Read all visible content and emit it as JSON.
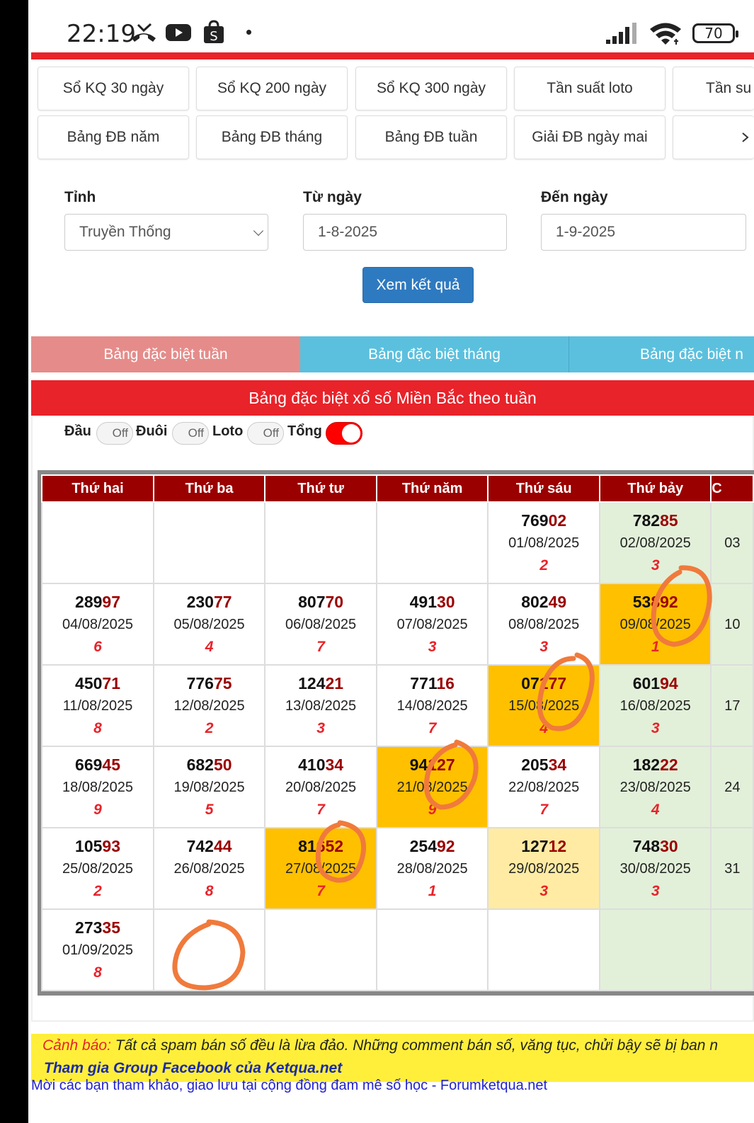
{
  "status_bar": {
    "time": "22:19",
    "battery": "70",
    "icons": [
      "missed-call-icon",
      "youtube-icon",
      "shopee-icon",
      "signal-icon",
      "wifi-icon",
      "battery-icon"
    ]
  },
  "menu": {
    "row1": [
      "Sổ KQ 30 ngày",
      "Sổ KQ 200 ngày",
      "Sổ KQ 300 ngày",
      "Tần suất loto",
      "Tần su"
    ],
    "row2": [
      "Bảng ĐB năm",
      "Bảng ĐB tháng",
      "Bảng ĐB tuần",
      "Giải ĐB ngày mai",
      ""
    ]
  },
  "form": {
    "province_label": "Tỉnh",
    "province_value": "Truyền Thống",
    "from_label": "Từ ngày",
    "from_value": "1-8-2025",
    "to_label": "Đến ngày",
    "to_value": "1-9-2025",
    "submit_label": "Xem kết quả"
  },
  "tabs": [
    {
      "label": "Bảng đặc biệt tuần",
      "color": "#e58c8a"
    },
    {
      "label": "Bảng đặc biệt tháng",
      "color": "#5bc0de"
    },
    {
      "label": "Bảng đặc biệt n",
      "color": "#5bc0de"
    }
  ],
  "section_title": "Bảng đặc biệt xổ số Miền Bắc theo tuần",
  "toggles": {
    "dau": "Đầu",
    "duoi": "Đuôi",
    "loto": "Loto",
    "tong": "Tổng",
    "off_text": "Off"
  },
  "table": {
    "headers": [
      "Thứ hai",
      "Thứ ba",
      "Thứ tư",
      "Thứ năm",
      "Thứ sáu",
      "Thứ bảy",
      "C"
    ],
    "rows": [
      [
        {
          "empty": true
        },
        {
          "empty": true
        },
        {
          "empty": true
        },
        {
          "empty": true
        },
        {
          "head": "769",
          "tail": "02",
          "date": "01/08/2025",
          "sum": "2"
        },
        {
          "head": "782",
          "tail": "85",
          "date": "02/08/2025",
          "sum": "3",
          "bg": "sat"
        },
        {
          "date": "03",
          "bg": "sun"
        }
      ],
      [
        {
          "head": "289",
          "tail": "97",
          "date": "04/08/2025",
          "sum": "6"
        },
        {
          "head": "230",
          "tail": "77",
          "date": "05/08/2025",
          "sum": "4"
        },
        {
          "head": "807",
          "tail": "70",
          "date": "06/08/2025",
          "sum": "7"
        },
        {
          "head": "491",
          "tail": "30",
          "date": "07/08/2025",
          "sum": "3"
        },
        {
          "head": "802",
          "tail": "49",
          "date": "08/08/2025",
          "sum": "3"
        },
        {
          "head": "53",
          "tail": "892",
          "date": "09/08/2025",
          "sum": "1",
          "bg": "orange"
        },
        {
          "date": "10",
          "bg": "sun"
        }
      ],
      [
        {
          "head": "450",
          "tail": "71",
          "date": "11/08/2025",
          "sum": "8"
        },
        {
          "head": "776",
          "tail": "75",
          "date": "12/08/2025",
          "sum": "2"
        },
        {
          "head": "124",
          "tail": "21",
          "date": "13/08/2025",
          "sum": "3"
        },
        {
          "head": "771",
          "tail": "16",
          "date": "14/08/2025",
          "sum": "7"
        },
        {
          "head": "07",
          "tail": "177",
          "date": "15/08/2025",
          "sum": "4",
          "bg": "orange"
        },
        {
          "head": "601",
          "tail": "94",
          "date": "16/08/2025",
          "sum": "3",
          "bg": "sat"
        },
        {
          "date": "17",
          "bg": "sun"
        }
      ],
      [
        {
          "head": "669",
          "tail": "45",
          "date": "18/08/2025",
          "sum": "9"
        },
        {
          "head": "682",
          "tail": "50",
          "date": "19/08/2025",
          "sum": "5"
        },
        {
          "head": "410",
          "tail": "34",
          "date": "20/08/2025",
          "sum": "7"
        },
        {
          "head": "94",
          "tail": "127",
          "date": "21/08/2025",
          "sum": "9",
          "bg": "orange"
        },
        {
          "head": "205",
          "tail": "34",
          "date": "22/08/2025",
          "sum": "7"
        },
        {
          "head": "182",
          "tail": "22",
          "date": "23/08/2025",
          "sum": "4",
          "bg": "sat"
        },
        {
          "date": "24",
          "bg": "sun"
        }
      ],
      [
        {
          "head": "105",
          "tail": "93",
          "date": "25/08/2025",
          "sum": "2"
        },
        {
          "head": "742",
          "tail": "44",
          "date": "26/08/2025",
          "sum": "8"
        },
        {
          "head": "81",
          "tail": "652",
          "date": "27/08/2025",
          "sum": "7",
          "bg": "orange"
        },
        {
          "head": "254",
          "tail": "92",
          "date": "28/08/2025",
          "sum": "1"
        },
        {
          "head": "127",
          "tail": "12",
          "date": "29/08/2025",
          "sum": "3",
          "bg": "lightyellow"
        },
        {
          "head": "748",
          "tail": "30",
          "date": "30/08/2025",
          "sum": "3",
          "bg": "sat"
        },
        {
          "date": "31",
          "bg": "sun"
        }
      ],
      [
        {
          "head": "273",
          "tail": "35",
          "date": "01/09/2025",
          "sum": "8"
        },
        {
          "empty": true
        },
        {
          "empty": true
        },
        {
          "empty": true
        },
        {
          "empty": true
        },
        {
          "empty": true,
          "bg": "sat"
        },
        {
          "empty": true,
          "bg": "sun"
        }
      ]
    ]
  },
  "footer": {
    "warning_label": "Cảnh báo:",
    "warning_text": " Tất cả spam bán số đều là lừa đảo. Những comment bán số, văng tục, chửi bậy sẽ bị ban n",
    "facebook_text": "Tham gia Group Facebook của Ketqua.net",
    "forum_text": "Mời các bạn tham khảo, giao lưu tại cộng đồng đam mê số học - Forumketqua.net"
  },
  "colors": {
    "red": "#e8232a",
    "dark_red": "#9b0000",
    "orange_cell": "#ffc000",
    "green_cell": "#e2f0d9",
    "annotation": "#f07a3c"
  }
}
